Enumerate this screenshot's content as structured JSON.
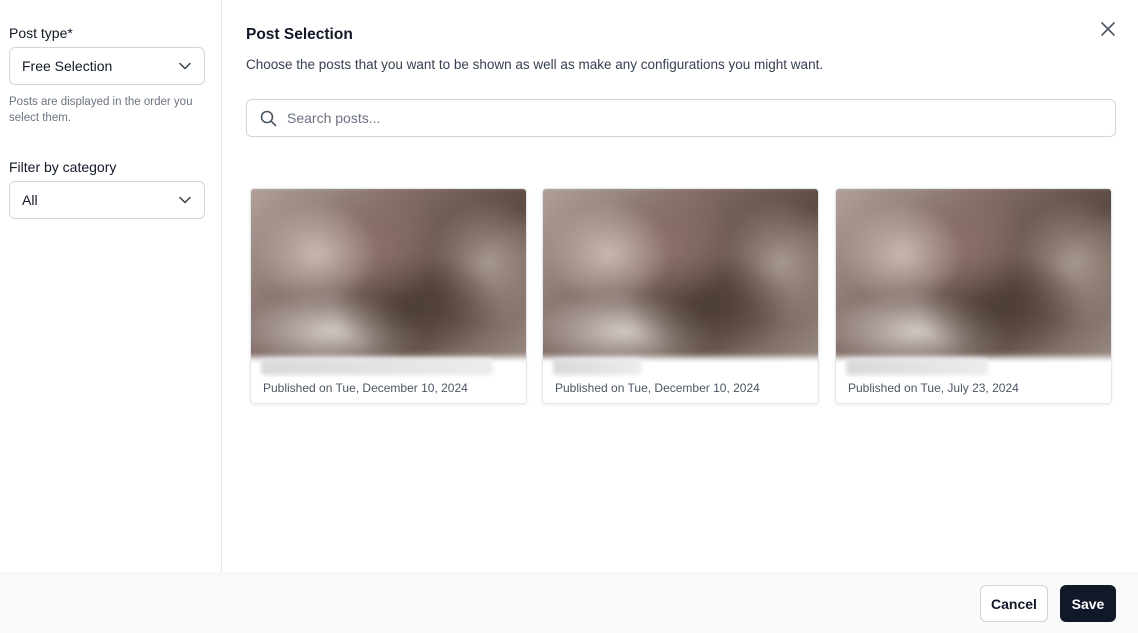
{
  "sidebar": {
    "post_type_label": "Post type*",
    "post_type_value": "Free Selection",
    "post_type_help": "Posts are displayed in the order you select them.",
    "category_label": "Filter by category",
    "category_value": "All"
  },
  "modal": {
    "title": "Post Selection",
    "subtitle": "Choose the posts that you want to be shown as well as make any configurations you might want.",
    "search_placeholder": "Search posts..."
  },
  "posts": [
    {
      "date": "Published on Tue, December 10, 2024"
    },
    {
      "date": "Published on Tue, December 10, 2024"
    },
    {
      "date": "Published on Tue, July 23, 2024"
    }
  ],
  "footer": {
    "cancel_label": "Cancel",
    "save_label": "Save"
  },
  "icons": {
    "select_chevron": "chevron-down-icon",
    "close": "close-icon",
    "search": "search-icon"
  },
  "colors": {
    "primary_button": "#111827",
    "border": "#d1d5db",
    "muted_text": "#6b7280"
  }
}
